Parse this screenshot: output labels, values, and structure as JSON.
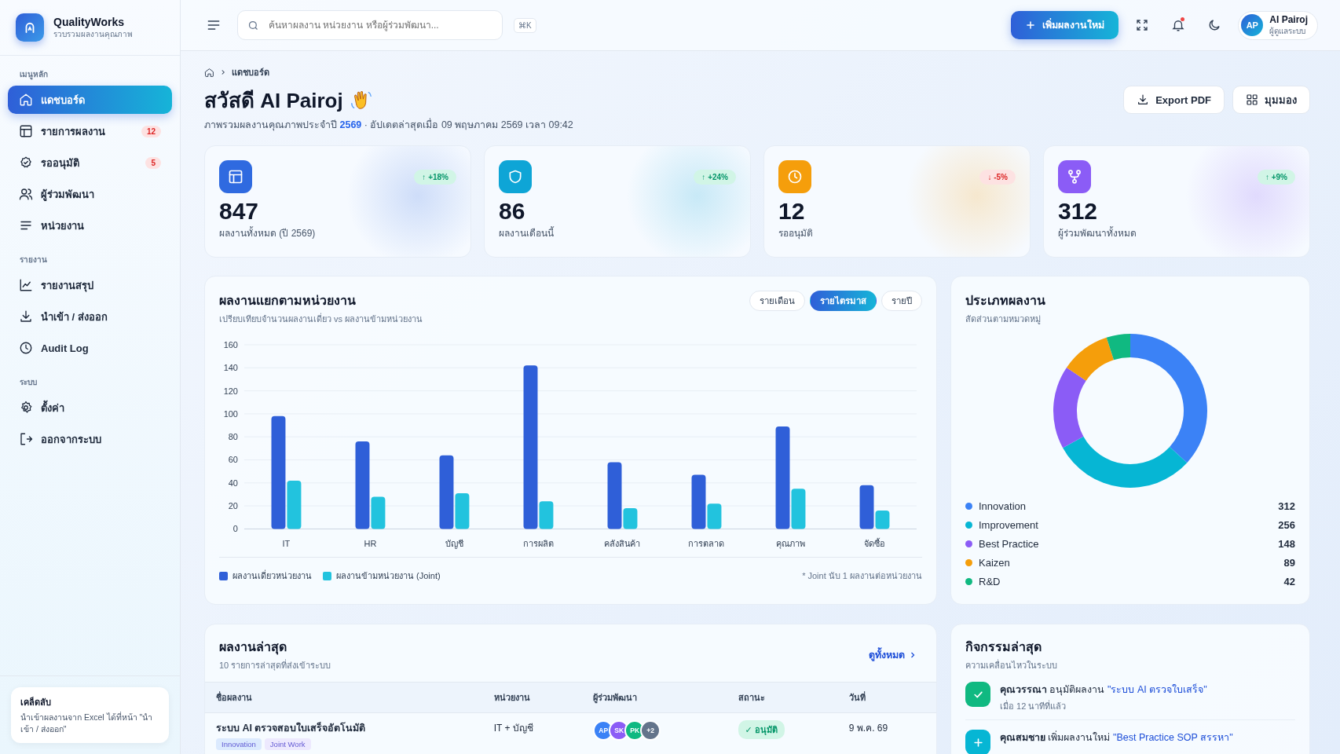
{
  "brand": {
    "name": "QualityWorks",
    "tagline": "รวบรวมผลงานคุณภาพ"
  },
  "sidebar": {
    "sections": [
      {
        "title": "เมนูหลัก",
        "items": [
          {
            "label": "แดชบอร์ด",
            "kind": "home",
            "selected": true
          },
          {
            "label": "รายการผลงาน",
            "kind": "table",
            "selected": false,
            "badge": "12"
          },
          {
            "label": "รออนุมัติ",
            "kind": "badge",
            "selected": false,
            "badge": "5"
          },
          {
            "label": "ผู้ร่วมพัฒนา",
            "kind": "users",
            "selected": false
          },
          {
            "label": "หน่วยงาน",
            "kind": "list",
            "selected": false
          }
        ]
      },
      {
        "title": "รายงาน",
        "items": [
          {
            "label": "รายงานสรุป",
            "kind": "chart",
            "selected": false
          },
          {
            "label": "นำเข้า / ส่งออก",
            "kind": "download",
            "selected": false
          },
          {
            "label": "Audit Log",
            "kind": "clock",
            "selected": false
          }
        ]
      },
      {
        "title": "ระบบ",
        "items": [
          {
            "label": "ตั้งค่า",
            "kind": "gear",
            "selected": false
          },
          {
            "label": "ออกจากระบบ",
            "kind": "logout",
            "selected": false
          }
        ]
      }
    ],
    "tip": {
      "title": "เคล็ดลับ",
      "text": "นำเข้าผลงานจาก Excel ได้ที่หน้า \"นำเข้า / ส่งออก\""
    }
  },
  "header": {
    "search": {
      "placeholder": "ค้นหาผลงาน หน่วยงาน หรือผู้ร่วมพัฒนา..."
    },
    "shortcut": "⌘K",
    "add_button": "เพิ่มผลงานใหม่",
    "unread": true,
    "user": {
      "initials": "AP",
      "name": "AI Pairoj",
      "role": "ผู้ดูแลระบบ"
    }
  },
  "page": {
    "breadcrumb": [
      "แดชบอร์ด"
    ],
    "title": "สวัสดี AI Pairoj",
    "subtitle": "ภาพรวมผลงานคุณภาพประจำปี **2569** · อัปเดตล่าสุดเมื่อ 09 พฤษภาคม 2569 เวลา 09:42",
    "actions": [
      {
        "label": "Export PDF",
        "kind": "download"
      },
      {
        "label": "มุมมอง",
        "kind": "grid"
      }
    ]
  },
  "stats": [
    {
      "value": "847",
      "label": "ผลงานทั้งหมด (ปี 2569)",
      "change": "↑ +18%",
      "rising": true,
      "kind": "table",
      "color": "#2f6ae0"
    },
    {
      "value": "86",
      "label": "ผลงานเดือนนี้",
      "change": "↑ +24%",
      "rising": true,
      "kind": "shield",
      "color": "#0ea5d6"
    },
    {
      "value": "12",
      "label": "รออนุมัติ",
      "change": "↓ -5%",
      "rising": false,
      "kind": "clock",
      "color": "#f59e0b"
    },
    {
      "value": "312",
      "label": "ผู้ร่วมพัฒนาทั้งหมด",
      "change": "↑ +9%",
      "rising": true,
      "kind": "share",
      "color": "#8b5cf6"
    }
  ],
  "chart": {
    "title": "ผลงานแยกตามหน่วยงาน",
    "subtitle": "เปรียบเทียบจำนวนผลงานเดี่ยว vs ผลงานข้ามหน่วยงาน",
    "periods": [
      {
        "label": "รายเดือน",
        "selected": false
      },
      {
        "label": "รายไตรมาส",
        "selected": true
      },
      {
        "label": "รายปี",
        "selected": false
      }
    ],
    "chart_data": {
      "type": "bar",
      "categories": [
        "IT",
        "HR",
        "บัญชี",
        "การผลิต",
        "คลังสินค้า",
        "การตลาด",
        "คุณภาพ",
        "จัดซื้อ"
      ],
      "series": [
        {
          "name": "ผลงานเดี่ยวหน่วยงาน",
          "color": "#2f5fd8",
          "values": [
            98,
            76,
            64,
            142,
            58,
            47,
            89,
            38
          ]
        },
        {
          "name": "ผลงานข้ามหน่วยงาน (Joint)",
          "color": "#22c3de",
          "values": [
            42,
            28,
            31,
            24,
            18,
            22,
            35,
            16
          ]
        }
      ],
      "ylim": [
        0,
        160
      ],
      "yticks": [
        0,
        20,
        40,
        60,
        80,
        100,
        120,
        140,
        160
      ],
      "grid": true
    },
    "note": "* Joint นับ 1 ผลงานต่อหน่วยงาน"
  },
  "types": {
    "title": "ประเภทผลงาน",
    "subtitle": "สัดส่วนตามหมวดหมู่",
    "chart_data": {
      "type": "donut",
      "categories": [
        "Innovation",
        "Improvement",
        "Best Practice",
        "Kaizen",
        "R&D"
      ],
      "values": [
        36.8,
        30.2,
        17.5,
        10.5,
        5.0
      ]
    },
    "legend": [
      {
        "count": "312",
        "color": "#3b82f6"
      },
      {
        "count": "256",
        "color": "#06b6d4"
      },
      {
        "count": "148",
        "color": "#8b5cf6"
      },
      {
        "count": "89",
        "color": "#f59e0b"
      },
      {
        "count": "42",
        "color": "#10b981"
      }
    ]
  },
  "recent": {
    "title": "ผลงานล่าสุด",
    "subtitle": "10 รายการล่าสุดที่ส่งเข้าระบบ",
    "link": "ดูทั้งหมด",
    "columns": [
      "ชื่อผลงาน",
      "หน่วยงาน",
      "ผู้ร่วมพัฒนา",
      "สถานะ",
      "วันที่"
    ],
    "rows": [
      {
        "title": "ระบบ AI ตรวจสอบใบเสร็จอัตโนมัติ",
        "tags": [
          {
            "label": "Innovation",
            "color": "#dbeafe"
          },
          {
            "label": "Joint Work",
            "color": "#ede9fe"
          }
        ],
        "unit": "IT + บัญชี",
        "contributors": [
          {
            "initials": "AP",
            "color": "#3b82f6"
          },
          {
            "initials": "SK",
            "color": "#8b5cf6"
          },
          {
            "initials": "PK",
            "color": "#10b981"
          },
          {
            "initials": "+2",
            "color": "#64748b"
          }
        ],
        "status": {
          "label": "✓ อนุมัติ",
          "kind": "approved"
        },
        "date": "9 พ.ค. 69"
      }
    ]
  },
  "activity": {
    "title": "กิจกรรมล่าสุด",
    "subtitle": "ความเคลื่อนไหวในระบบ",
    "items": [
      {
        "kind": "check",
        "color": "#10b981",
        "actor": "คุณวรรณา",
        "action": "อนุมัติผลงาน",
        "target": "\"ระบบ AI ตรวจใบเสร็จ\"",
        "time": "เมื่อ 12 นาทีที่แล้ว"
      },
      {
        "kind": "plus",
        "color": "#06b6d4",
        "actor": "คุณสมชาย",
        "action": "เพิ่มผลงานใหม่",
        "target": "\"Best Practice SOP สรรหา\""
      }
    ]
  }
}
